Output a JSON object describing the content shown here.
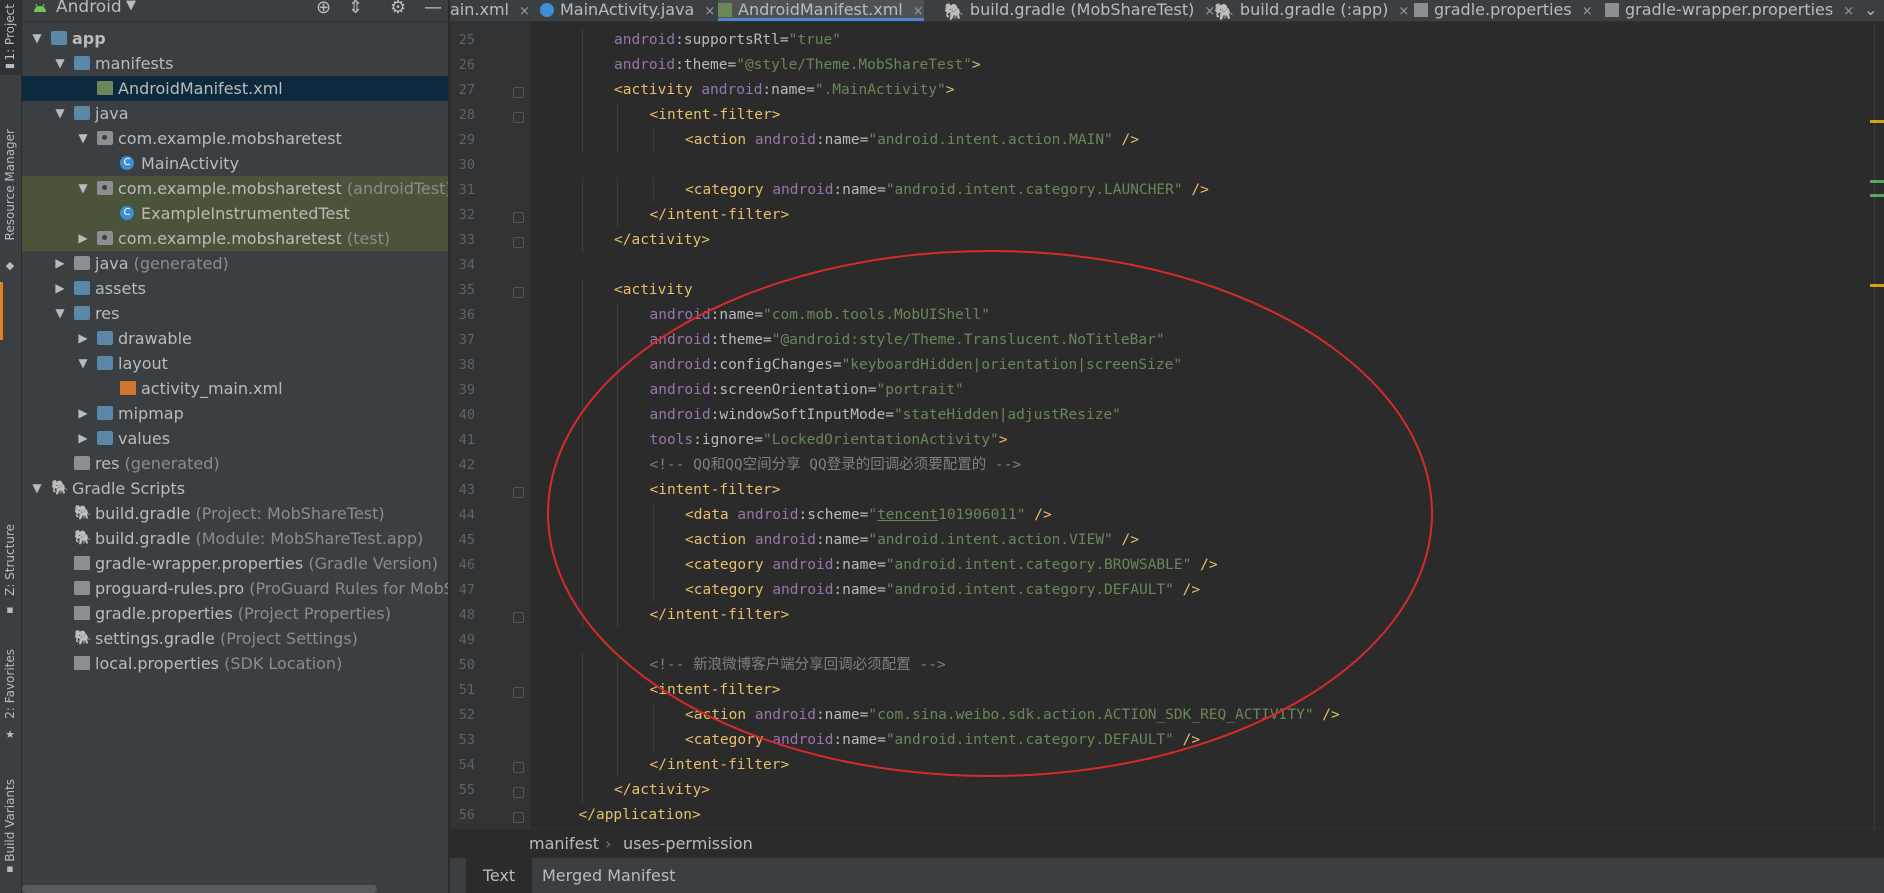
{
  "tool_window_bar": {
    "project": "1: Project",
    "resource_manager": "Resource Manager",
    "structure": "Z: Structure",
    "favorites": "2: Favorites",
    "build_variants": "Build Variants"
  },
  "project_panel": {
    "view": "Android",
    "tree": [
      {
        "label": "app",
        "suffix": "",
        "depth": 0,
        "arrow": "down",
        "icon": "folder-icon",
        "bold": true
      },
      {
        "label": "manifests",
        "suffix": "",
        "depth": 1,
        "arrow": "down",
        "icon": "folder-icon"
      },
      {
        "label": "AndroidManifest.xml",
        "suffix": "",
        "depth": 2,
        "arrow": "",
        "icon": "manifest-file-icon",
        "selected": true
      },
      {
        "label": "java",
        "suffix": "",
        "depth": 1,
        "arrow": "down",
        "icon": "folder-icon"
      },
      {
        "label": "com.example.mobsharetest",
        "suffix": "",
        "depth": 2,
        "arrow": "down",
        "icon": "package-icon"
      },
      {
        "label": "MainActivity",
        "suffix": "",
        "depth": 3,
        "arrow": "",
        "icon": "class-icon"
      },
      {
        "label": "com.example.mobsharetest",
        "suffix": " (androidTest)",
        "depth": 2,
        "arrow": "down",
        "icon": "package-icon",
        "test": true
      },
      {
        "label": "ExampleInstrumentedTest",
        "suffix": "",
        "depth": 3,
        "arrow": "",
        "icon": "test-class-icon",
        "test": true
      },
      {
        "label": "com.example.mobsharetest",
        "suffix": " (test)",
        "depth": 2,
        "arrow": "right",
        "icon": "package-icon",
        "test": true
      },
      {
        "label": "java",
        "suffix": " (generated)",
        "depth": 1,
        "arrow": "right",
        "icon": "generated-folder-icon"
      },
      {
        "label": "assets",
        "suffix": "",
        "depth": 1,
        "arrow": "right",
        "icon": "folder-icon"
      },
      {
        "label": "res",
        "suffix": "",
        "depth": 1,
        "arrow": "down",
        "icon": "folder-icon"
      },
      {
        "label": "drawable",
        "suffix": "",
        "depth": 2,
        "arrow": "right",
        "icon": "folder-icon"
      },
      {
        "label": "layout",
        "suffix": "",
        "depth": 2,
        "arrow": "down",
        "icon": "folder-icon"
      },
      {
        "label": "activity_main.xml",
        "suffix": "",
        "depth": 3,
        "arrow": "",
        "icon": "layout-file-icon"
      },
      {
        "label": "mipmap",
        "suffix": "",
        "depth": 2,
        "arrow": "right",
        "icon": "folder-icon"
      },
      {
        "label": "values",
        "suffix": "",
        "depth": 2,
        "arrow": "right",
        "icon": "folder-icon"
      },
      {
        "label": "res",
        "suffix": " (generated)",
        "depth": 1,
        "arrow": "",
        "icon": "generated-folder-icon"
      },
      {
        "label": "Gradle Scripts",
        "suffix": "",
        "depth": 0,
        "arrow": "down",
        "icon": "gradle-icon"
      },
      {
        "label": "build.gradle",
        "suffix": " (Project: MobShareTest)",
        "depth": 1,
        "arrow": "",
        "icon": "gradle-icon"
      },
      {
        "label": "build.gradle",
        "suffix": " (Module: MobShareTest.app)",
        "depth": 1,
        "arrow": "",
        "icon": "gradle-icon"
      },
      {
        "label": "gradle-wrapper.properties",
        "suffix": " (Gradle Version)",
        "depth": 1,
        "arrow": "",
        "icon": "properties-icon"
      },
      {
        "label": "proguard-rules.pro",
        "suffix": " (ProGuard Rules for MobShar",
        "depth": 1,
        "arrow": "",
        "icon": "proguard-icon"
      },
      {
        "label": "gradle.properties",
        "suffix": " (Project Properties)",
        "depth": 1,
        "arrow": "",
        "icon": "properties-icon"
      },
      {
        "label": "settings.gradle",
        "suffix": " (Project Settings)",
        "depth": 1,
        "arrow": "",
        "icon": "gradle-icon"
      },
      {
        "label": "local.properties",
        "suffix": " (SDK Location)",
        "depth": 1,
        "arrow": "",
        "icon": "properties-icon"
      }
    ]
  },
  "tabs": [
    {
      "label": "ain.xml",
      "icon": "layout-file-icon",
      "active": false
    },
    {
      "label": "MainActivity.java",
      "icon": "class-icon",
      "active": false
    },
    {
      "label": "AndroidManifest.xml",
      "icon": "manifest-file-icon",
      "active": true
    },
    {
      "label": "build.gradle (MobShareTest)",
      "icon": "gradle-icon",
      "active": false
    },
    {
      "label": "build.gradle (:app)",
      "icon": "gradle-icon",
      "active": false
    },
    {
      "label": "gradle.properties",
      "icon": "properties-icon",
      "active": false
    },
    {
      "label": "gradle-wrapper.properties",
      "icon": "properties-icon",
      "active": false
    }
  ],
  "code_lines": [
    {
      "n": "25",
      "indent": 2,
      "fold": false,
      "html": "<span class='ns'>android</span><span class='a'>:supportsRtl=</span><span class='v'>\"true\"</span>"
    },
    {
      "n": "26",
      "indent": 2,
      "fold": false,
      "html": "<span class='ns'>android</span><span class='a'>:theme=</span><span class='v'>\"@style/Theme.MobShareTest\"</span><span class='t'>&gt;</span>"
    },
    {
      "n": "27",
      "indent": 2,
      "fold": true,
      "html": "<span class='t'>&lt;activity </span><span class='ns'>android</span><span class='a'>:name=</span><span class='v'>\".MainActivity\"</span><span class='t'>&gt;</span>"
    },
    {
      "n": "28",
      "indent": 3,
      "fold": true,
      "html": "<span class='t'>&lt;intent-filter&gt;</span>"
    },
    {
      "n": "29",
      "indent": 4,
      "fold": false,
      "html": "<span class='t'>&lt;action </span><span class='ns'>android</span><span class='a'>:name=</span><span class='v'>\"android.intent.action.MAIN\"</span><span class='t'> /&gt;</span>"
    },
    {
      "n": "30",
      "indent": 0,
      "fold": false,
      "html": ""
    },
    {
      "n": "31",
      "indent": 4,
      "fold": false,
      "html": "<span class='t'>&lt;category </span><span class='ns'>android</span><span class='a'>:name=</span><span class='v'>\"android.intent.category.LAUNCHER\"</span><span class='t'> /&gt;</span>"
    },
    {
      "n": "32",
      "indent": 3,
      "fold": true,
      "html": "<span class='t'>&lt;/intent-filter&gt;</span>"
    },
    {
      "n": "33",
      "indent": 2,
      "fold": true,
      "html": "<span class='t'>&lt;/activity&gt;</span>"
    },
    {
      "n": "34",
      "indent": 0,
      "fold": false,
      "html": ""
    },
    {
      "n": "35",
      "indent": 2,
      "fold": true,
      "html": "<span class='t'>&lt;activity</span>"
    },
    {
      "n": "36",
      "indent": 3,
      "fold": false,
      "html": "<span class='ns'>android</span><span class='a'>:name=</span><span class='v'>\"com.mob.tools.MobUIShell\"</span>"
    },
    {
      "n": "37",
      "indent": 3,
      "fold": false,
      "html": "<span class='ns'>android</span><span class='a'>:theme=</span><span class='v'>\"@android:style/Theme.Translucent.NoTitleBar\"</span>"
    },
    {
      "n": "38",
      "indent": 3,
      "fold": false,
      "html": "<span class='ns'>android</span><span class='a'>:configChanges=</span><span class='v'>\"keyboardHidden|orientation|screenSize\"</span>"
    },
    {
      "n": "39",
      "indent": 3,
      "fold": false,
      "html": "<span class='ns'>android</span><span class='a'>:screenOrientation=</span><span class='v'>\"portrait\"</span>"
    },
    {
      "n": "40",
      "indent": 3,
      "fold": false,
      "html": "<span class='ns'>android</span><span class='a'>:windowSoftInputMode=</span><span class='v'>\"stateHidden|adjustResize\"</span>"
    },
    {
      "n": "41",
      "indent": 3,
      "fold": false,
      "html": "<span class='ns'>tools</span><span class='a'>:ignore=</span><span class='v'>\"LockedOrientationActivity\"</span><span class='t'>&gt;</span>"
    },
    {
      "n": "42",
      "indent": 3,
      "fold": false,
      "html": "<span class='c'>&lt;!-- QQ和QQ空间分享 QQ登录的回调必须要配置的 --&gt;</span>"
    },
    {
      "n": "43",
      "indent": 3,
      "fold": true,
      "html": "<span class='t'>&lt;intent-filter&gt;</span>"
    },
    {
      "n": "44",
      "indent": 4,
      "fold": false,
      "html": "<span class='t'>&lt;data </span><span class='ns'>android</span><span class='a'>:scheme=</span><span class='v'>\"<u>tencent</u>101906011\"</span><span class='t'> /&gt;</span>"
    },
    {
      "n": "45",
      "indent": 4,
      "fold": false,
      "html": "<span class='t'>&lt;action </span><span class='ns'>android</span><span class='a'>:name=</span><span class='v'>\"android.intent.action.VIEW\"</span><span class='t'> /&gt;</span>"
    },
    {
      "n": "46",
      "indent": 4,
      "fold": false,
      "html": "<span class='t'>&lt;category </span><span class='ns'>android</span><span class='a'>:name=</span><span class='v'>\"android.intent.category.BROWSABLE\"</span><span class='t'> /&gt;</span>"
    },
    {
      "n": "47",
      "indent": 4,
      "fold": false,
      "html": "<span class='t'>&lt;category </span><span class='ns'>android</span><span class='a'>:name=</span><span class='v'>\"android.intent.category.DEFAULT\"</span><span class='t'> /&gt;</span>"
    },
    {
      "n": "48",
      "indent": 3,
      "fold": true,
      "html": "<span class='t'>&lt;/intent-filter&gt;</span>"
    },
    {
      "n": "49",
      "indent": 0,
      "fold": false,
      "html": ""
    },
    {
      "n": "50",
      "indent": 3,
      "fold": false,
      "html": "<span class='c'>&lt;!-- 新浪微博客户端分享回调必须配置 --&gt;</span>"
    },
    {
      "n": "51",
      "indent": 3,
      "fold": true,
      "html": "<span class='t'>&lt;intent-filter&gt;</span>"
    },
    {
      "n": "52",
      "indent": 4,
      "fold": false,
      "html": "<span class='t'>&lt;action </span><span class='ns'>android</span><span class='a'>:name=</span><span class='v'>\"com.sina.weibo.sdk.action.ACTION_SDK_REQ_ACTIVITY\"</span><span class='t'> /&gt;</span>"
    },
    {
      "n": "53",
      "indent": 4,
      "fold": false,
      "html": "<span class='t'>&lt;category </span><span class='ns'>android</span><span class='a'>:name=</span><span class='v'>\"android.intent.category.DEFAULT\"</span><span class='t'> /&gt;</span>"
    },
    {
      "n": "54",
      "indent": 3,
      "fold": true,
      "html": "<span class='t'>&lt;/intent-filter&gt;</span>"
    },
    {
      "n": "55",
      "indent": 2,
      "fold": true,
      "html": "<span class='t'>&lt;/activity&gt;</span>"
    },
    {
      "n": "56",
      "indent": 1,
      "fold": true,
      "html": "<span class='t'>&lt;/application&gt;</span>"
    }
  ],
  "breadcrumb": {
    "first": "manifest",
    "sep": "›",
    "second": "uses-permission"
  },
  "bottom_tabs": {
    "text": "Text",
    "merged": "Merged Manifest"
  },
  "colors": {
    "accent": "#4a88c7",
    "selection": "#0d293e",
    "test_bg": "#49543a",
    "annotation": "#d82a2a",
    "tag": "#e8bf6a",
    "value": "#6a8759",
    "namespace": "#9876aa"
  }
}
